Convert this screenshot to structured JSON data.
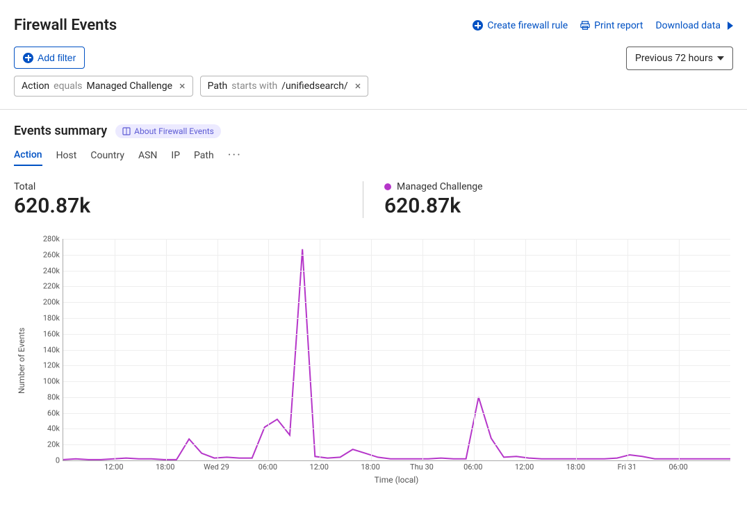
{
  "header": {
    "title": "Firewall Events",
    "create_rule": "Create firewall rule",
    "print_report": "Print report",
    "download_data": "Download data"
  },
  "filters": {
    "add_filter": "Add filter",
    "time_range": "Previous 72 hours",
    "chips": [
      {
        "field": "Action",
        "op": "equals",
        "value": "Managed Challenge"
      },
      {
        "field": "Path",
        "op": "starts with",
        "value": "/unifiedsearch/"
      }
    ]
  },
  "summary": {
    "title": "Events summary",
    "about": "About Firewall Events",
    "tabs": [
      "Action",
      "Host",
      "Country",
      "ASN",
      "IP",
      "Path"
    ],
    "active_tab": 0,
    "total_label": "Total",
    "total_value": "620.87k",
    "series_label": "Managed Challenge",
    "series_value": "620.87k",
    "series_color": "#b536c9"
  },
  "chart_data": {
    "type": "line",
    "title": "",
    "xlabel": "Time (local)",
    "ylabel": "Number of Events",
    "ylim": [
      0,
      280000
    ],
    "y_ticks": [
      "0",
      "20k",
      "40k",
      "60k",
      "80k",
      "100k",
      "120k",
      "140k",
      "160k",
      "180k",
      "200k",
      "220k",
      "240k",
      "260k",
      "280k"
    ],
    "x_ticks": [
      "12:00",
      "18:00",
      "Wed 29",
      "06:00",
      "12:00",
      "18:00",
      "Thu 30",
      "06:00",
      "12:00",
      "18:00",
      "Fri 31",
      "06:00"
    ],
    "series": [
      {
        "name": "Managed Challenge",
        "color": "#b536c9",
        "values": [
          1000,
          2000,
          1000,
          1000,
          2000,
          3000,
          2000,
          2000,
          1000,
          1000,
          27000,
          9000,
          3000,
          4000,
          3000,
          3000,
          42000,
          52000,
          32000,
          267000,
          5000,
          3000,
          4000,
          14000,
          9000,
          4000,
          2000,
          2000,
          2000,
          2000,
          3000,
          2000,
          2000,
          80000,
          28000,
          4000,
          5000,
          3000,
          2000,
          2000,
          2000,
          2000,
          2000,
          2000,
          3000,
          7000,
          5000,
          2000,
          2000,
          2000,
          2000,
          2000,
          2000,
          2000
        ]
      }
    ]
  }
}
